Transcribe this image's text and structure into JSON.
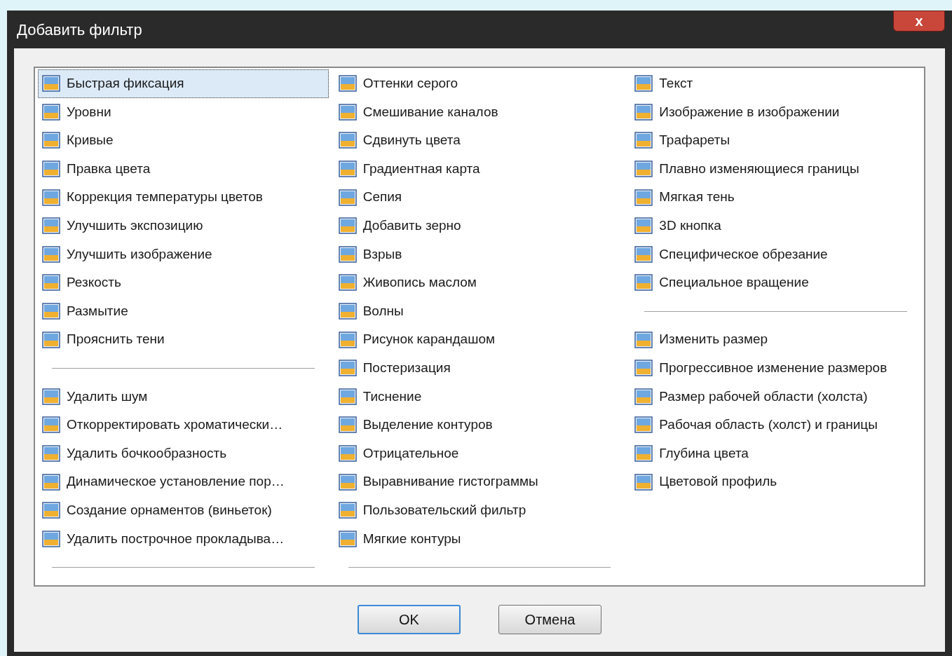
{
  "window": {
    "title": "Добавить фильтр",
    "close": "x"
  },
  "columns": [
    [
      {
        "kind": "item",
        "label": "Быстрая фиксация",
        "selected": true
      },
      {
        "kind": "item",
        "label": "Уровни",
        "selected": false
      },
      {
        "kind": "item",
        "label": "Кривые",
        "selected": false
      },
      {
        "kind": "item",
        "label": "Правка цвета",
        "selected": false
      },
      {
        "kind": "item",
        "label": "Коррекция температуры цветов",
        "selected": false
      },
      {
        "kind": "item",
        "label": "Улучшить экспозицию",
        "selected": false
      },
      {
        "kind": "item",
        "label": "Улучшить изображение",
        "selected": false
      },
      {
        "kind": "item",
        "label": "Резкость",
        "selected": false
      },
      {
        "kind": "item",
        "label": "Размытие",
        "selected": false
      },
      {
        "kind": "item",
        "label": "Прояснить тени",
        "selected": false
      },
      {
        "kind": "separator"
      },
      {
        "kind": "item",
        "label": "Удалить шум",
        "selected": false
      },
      {
        "kind": "item",
        "label": "Откорректировать хроматически…",
        "selected": false
      },
      {
        "kind": "item",
        "label": "Удалить бочкообразность",
        "selected": false
      },
      {
        "kind": "item",
        "label": "Динамическое установление пор…",
        "selected": false
      },
      {
        "kind": "item",
        "label": "Создание орнаментов (виньеток)",
        "selected": false
      },
      {
        "kind": "item",
        "label": "Удалить построчное прокладыва…",
        "selected": false
      },
      {
        "kind": "separator"
      }
    ],
    [
      {
        "kind": "item",
        "label": "Оттенки серого",
        "selected": false
      },
      {
        "kind": "item",
        "label": "Смешивание каналов",
        "selected": false
      },
      {
        "kind": "item",
        "label": "Сдвинуть цвета",
        "selected": false
      },
      {
        "kind": "item",
        "label": "Градиентная карта",
        "selected": false
      },
      {
        "kind": "item",
        "label": "Сепия",
        "selected": false
      },
      {
        "kind": "item",
        "label": "Добавить зерно",
        "selected": false
      },
      {
        "kind": "item",
        "label": "Взрыв",
        "selected": false
      },
      {
        "kind": "item",
        "label": "Живопись маслом",
        "selected": false
      },
      {
        "kind": "item",
        "label": "Волны",
        "selected": false
      },
      {
        "kind": "item",
        "label": "Рисунок карандашом",
        "selected": false
      },
      {
        "kind": "item",
        "label": "Постеризация",
        "selected": false
      },
      {
        "kind": "item",
        "label": "Тиснение",
        "selected": false
      },
      {
        "kind": "item",
        "label": "Выделение контуров",
        "selected": false
      },
      {
        "kind": "item",
        "label": "Отрицательное",
        "selected": false
      },
      {
        "kind": "item",
        "label": "Выравнивание гистограммы",
        "selected": false
      },
      {
        "kind": "item",
        "label": "Пользовательский фильтр",
        "selected": false
      },
      {
        "kind": "item",
        "label": "Мягкие контуры",
        "selected": false
      },
      {
        "kind": "separator"
      }
    ],
    [
      {
        "kind": "item",
        "label": "Текст",
        "selected": false
      },
      {
        "kind": "item",
        "label": "Изображение в изображении",
        "selected": false
      },
      {
        "kind": "item",
        "label": "Трафареты",
        "selected": false
      },
      {
        "kind": "item",
        "label": "Плавно изменяющиеся границы",
        "selected": false
      },
      {
        "kind": "item",
        "label": "Мягкая тень",
        "selected": false
      },
      {
        "kind": "item",
        "label": "3D кнопка",
        "selected": false
      },
      {
        "kind": "item",
        "label": "Специфическое обрезание",
        "selected": false
      },
      {
        "kind": "item",
        "label": "Специальное вращение",
        "selected": false
      },
      {
        "kind": "separator"
      },
      {
        "kind": "item",
        "label": "Изменить размер",
        "selected": false
      },
      {
        "kind": "item",
        "label": "Прогрессивное изменение размеров",
        "selected": false
      },
      {
        "kind": "item",
        "label": "Размер рабочей области (холста)",
        "selected": false
      },
      {
        "kind": "item",
        "label": "Рабочая область (холст) и границы",
        "selected": false
      },
      {
        "kind": "item",
        "label": "Глубина цвета",
        "selected": false
      },
      {
        "kind": "item",
        "label": "Цветовой профиль",
        "selected": false
      }
    ]
  ],
  "buttons": [
    {
      "label": "OK",
      "default": true
    },
    {
      "label": "Отмена",
      "default": false
    }
  ]
}
